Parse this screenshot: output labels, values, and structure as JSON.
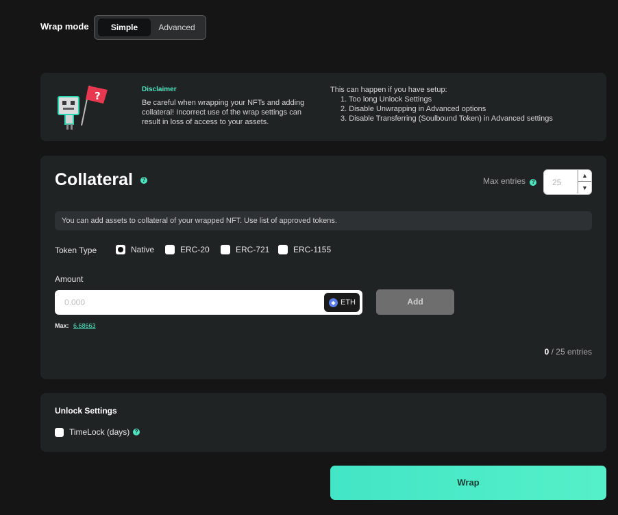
{
  "wrap_mode": {
    "label": "Wrap mode",
    "options": [
      "Simple",
      "Advanced"
    ],
    "selected": "Simple"
  },
  "disclaimer": {
    "title": "Disclaimer",
    "text": "Be careful when wrapping your NFTs and adding collateral! Incorrect use of the wrap settings can result in loss of access to your assets.",
    "intro": "This can happen if you have setup:",
    "items": [
      "1. Too long Unlock Settings",
      "2. Disable Unwrapping in Advanced options",
      "3. Disable Transferring (Soulbound Token) in Advanced settings"
    ],
    "illustration_icon": "question-flag-icon"
  },
  "collateral": {
    "title": "Collateral",
    "help_glyph": "?",
    "max_entries_label": "Max entries",
    "max_entries_value": "25",
    "info": "You can add assets to collateral of your wrapped NFT. Use list of approved tokens.",
    "token_type_label": "Token Type",
    "token_types": [
      "Native",
      "ERC-20",
      "ERC-721",
      "ERC-1155"
    ],
    "selected_token_type": "Native",
    "amount_label": "Amount",
    "amount_placeholder": "0.000",
    "currency": "ETH",
    "add_label": "Add",
    "max_label": "Max:",
    "max_value": "6.68663",
    "entries_current": "0",
    "entries_total": "/ 25 entries"
  },
  "unlock_settings": {
    "title": "Unlock Settings",
    "timelock_label": "TimeLock (days)"
  },
  "wrap_button": "Wrap",
  "colors": {
    "accent": "#4de6c0",
    "background": "#151515",
    "card": "#202324"
  }
}
